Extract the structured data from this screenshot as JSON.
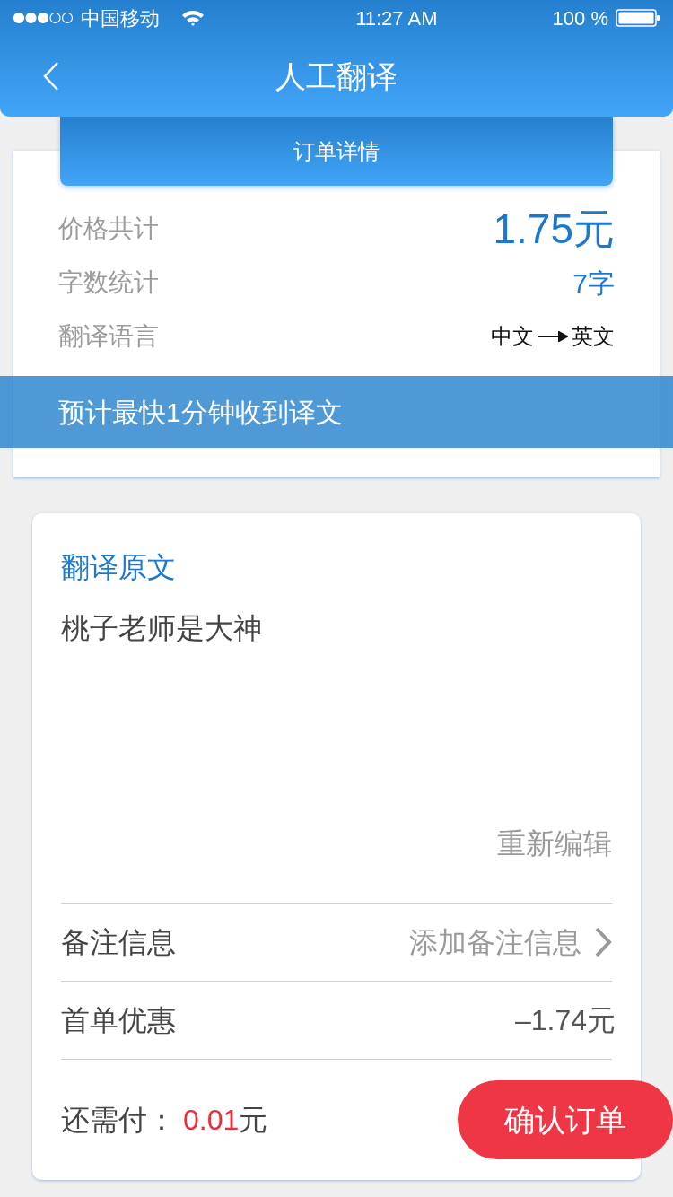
{
  "status_bar": {
    "carrier": "中国移动",
    "time": "11:27 AM",
    "battery": "100 %"
  },
  "nav": {
    "title": "人工翻译"
  },
  "order_tab": {
    "label": "订单详情"
  },
  "summary": [
    {
      "kind": "price",
      "label": "价格共计",
      "value": "1.75元"
    },
    {
      "kind": "count",
      "label": "字数统计",
      "value": "7字"
    },
    {
      "kind": "language",
      "label": "翻译语言",
      "from": "中文",
      "to": "英文"
    }
  ],
  "notice": "预计最快1分钟收到译文",
  "source": {
    "heading": "翻译原文",
    "text": "桃子老师是大神",
    "edit": "重新编辑"
  },
  "rows": [
    {
      "kind": "link",
      "label": "备注信息",
      "value": "添加备注信息"
    },
    {
      "kind": "plain",
      "label": "首单优惠",
      "value": "–1.74元"
    }
  ],
  "footer": {
    "label": "还需付：",
    "amount": "0.01",
    "unit": "元",
    "button": "确认订单"
  }
}
